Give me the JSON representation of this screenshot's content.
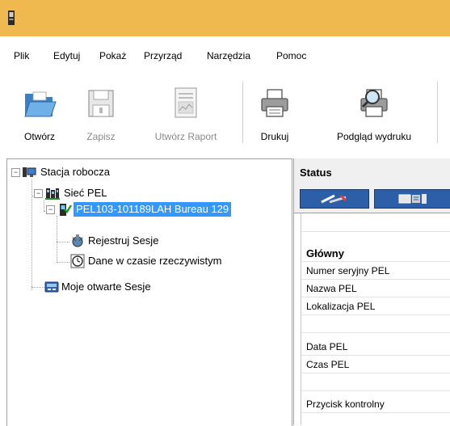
{
  "menu": [
    "Plik",
    "Edytuj",
    "Pokaż",
    "Przyrząd",
    "Narzędzia",
    "Pomoc"
  ],
  "toolbar": {
    "open": "Otwórz",
    "save": "Zapisz",
    "report": "Utwórz Raport",
    "print": "Drukuj",
    "preview": "Podgląd wydruku"
  },
  "tree": {
    "workstation": "Stacja robocza",
    "network": "Sieć PEL",
    "device": "PEL103-101189LAH Bureau 129",
    "record": "Rejestruj Sesje",
    "realtime": "Dane w czasie rzeczywistym",
    "sessions": "Moje otwarte Sesje"
  },
  "status": {
    "title": "Status",
    "rows": [
      "",
      "Główny",
      "Numer seryjny PEL",
      "Nazwa PEL",
      "Lokalizacja PEL",
      "",
      "Data PEL",
      "Czas PEL",
      "",
      "Przycisk kontrolny"
    ]
  },
  "colors": {
    "titlebar": "#f0b94f",
    "selection": "#3399ff",
    "tab": "#2d5fa8"
  }
}
